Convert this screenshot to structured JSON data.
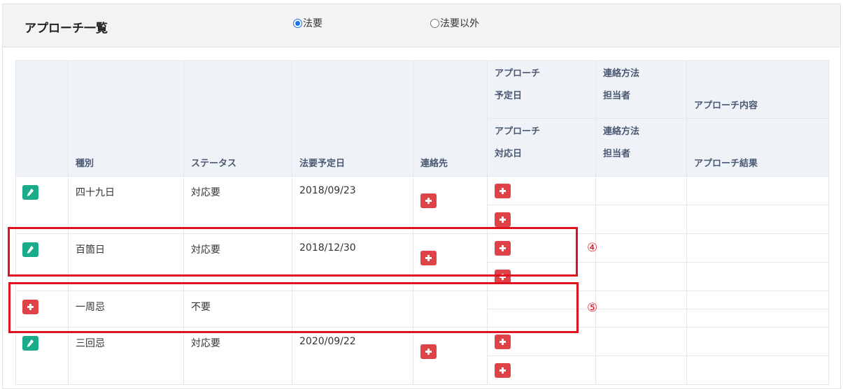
{
  "header": {
    "title": "アプローチ一覧",
    "radio_options": [
      {
        "label": "法要",
        "selected": true
      },
      {
        "label": "法要以外",
        "selected": false
      }
    ]
  },
  "table": {
    "columns": {
      "kind": "種別",
      "status": "ステータス",
      "date": "法要予定日",
      "contact": "連絡先",
      "approach_planned_l1": "アプローチ",
      "approach_planned_l2": "予定日",
      "method_top_l1": "連絡方法",
      "method_top_l2": "担当者",
      "approach_content": "アプローチ内容",
      "approach_done_l1": "アプローチ",
      "approach_done_l2": "対応日",
      "method_bottom_l1": "連絡方法",
      "method_bottom_l2": "担当者",
      "approach_result": "アプローチ結果"
    },
    "rows": [
      {
        "kind": "四十九日",
        "status": "対応要",
        "date": "2018/09/23",
        "action_icon": "pencil-icon"
      },
      {
        "kind": "百箇日",
        "status": "対応要",
        "date": "2018/12/30",
        "action_icon": "pencil-icon"
      },
      {
        "kind": "一周忌",
        "status": "不要",
        "date": "",
        "action_icon": "plus-icon"
      },
      {
        "kind": "三回忌",
        "status": "対応要",
        "date": "2020/09/22",
        "action_icon": "pencil-icon"
      }
    ]
  },
  "annotations": {
    "marker_4": "④",
    "marker_5": "⑤"
  },
  "colors": {
    "edit_button": "#1aab8a",
    "add_button": "#df4347",
    "header_bg": "#eff3f8",
    "highlight": "#e0121f"
  }
}
